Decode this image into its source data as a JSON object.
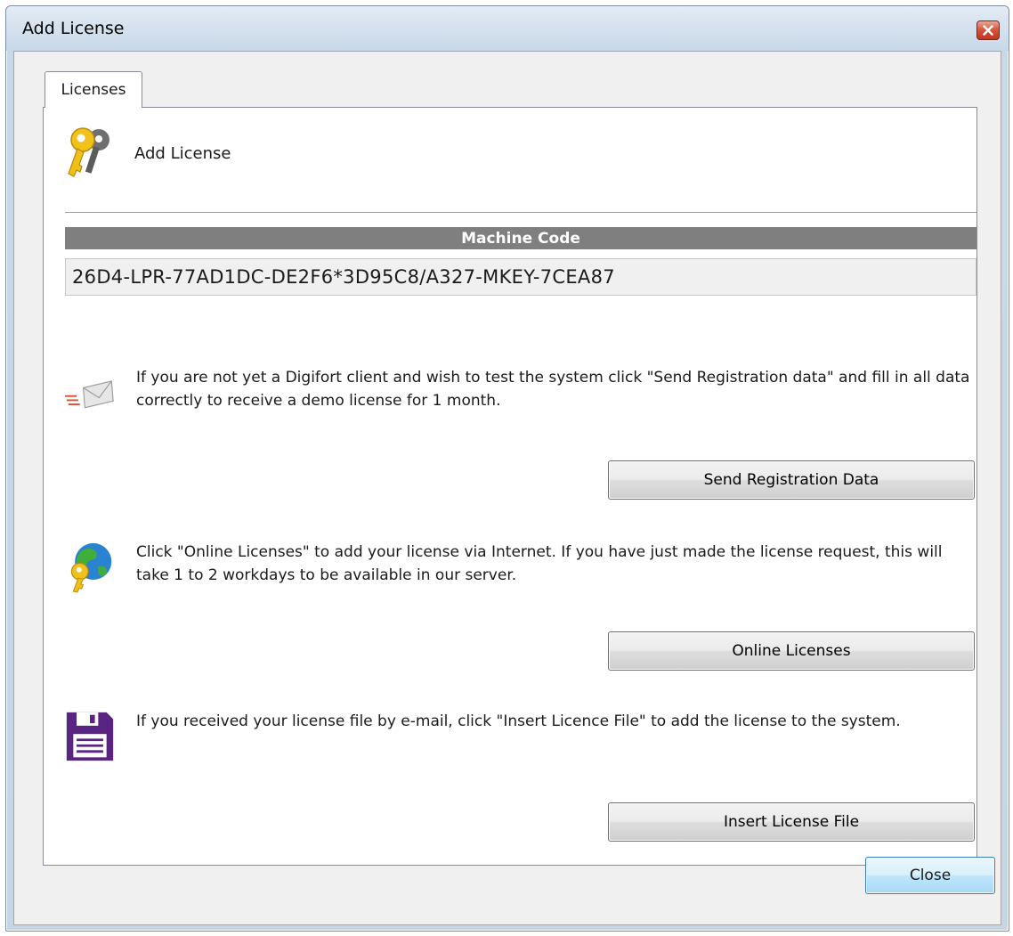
{
  "window": {
    "title": "Add License"
  },
  "tabs": [
    {
      "label": "Licenses",
      "selected": true
    }
  ],
  "header": {
    "title": "Add License",
    "icon": "keys-icon"
  },
  "machine_code": {
    "label": "Machine Code",
    "value": "26D4-LPR-77AD1DC-DE2F6*3D95C8/A327-MKEY-7CEA87"
  },
  "sections": {
    "registration": {
      "icon": "mail-icon",
      "text": "If you are not yet a Digifort client and wish to test the system click \"Send Registration data\" and fill in all data correctly to receive a demo license for 1 month.",
      "button": "Send Registration Data"
    },
    "online": {
      "icon": "globe-key-icon",
      "text": "Click \"Online Licenses\" to add your license via Internet. If you have just made the license request, this will take 1 to 2 workdays to be available in our server.",
      "button": "Online Licenses"
    },
    "file": {
      "icon": "floppy-disk-icon",
      "text": "If you received your license file by e-mail, click \"Insert Licence File\" to add the license to the system.",
      "button": "Insert License File"
    }
  },
  "footer": {
    "close_label": "Close"
  },
  "colors": {
    "machine_code_bar": "#7f7f7f",
    "close_button_border": "#3c7fb1",
    "title_close": "#c1361f"
  }
}
